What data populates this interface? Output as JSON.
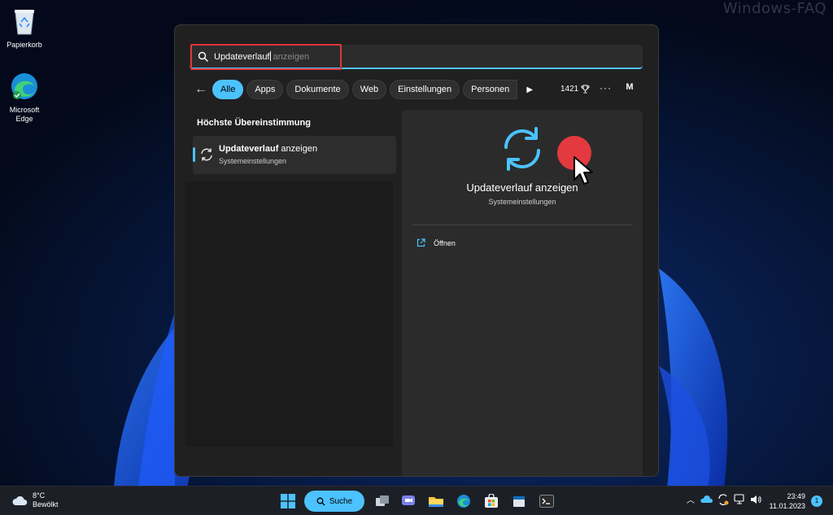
{
  "desktop": {
    "watermark": "Windows-FAQ",
    "icons": [
      {
        "label": "Papierkorb",
        "icon": "recycle-bin-icon"
      },
      {
        "label": "Microsoft Edge",
        "icon": "edge-icon"
      }
    ]
  },
  "search": {
    "query": "Updateverlauf",
    "suggestion": " anzeigen"
  },
  "filters": {
    "back": "←",
    "tabs": [
      "Alle",
      "Apps",
      "Dokumente",
      "Web",
      "Einstellungen",
      "Personen"
    ],
    "active_tab": "Alle",
    "play": "▶",
    "points": "1421",
    "more": "···",
    "account_initial": "M"
  },
  "results": {
    "section_title": "Höchste Übereinstimmung",
    "best_match": {
      "title_bold": "Updateverlauf",
      "title_rest": " anzeigen",
      "subtitle": "Systemeinstellungen"
    }
  },
  "detail": {
    "title": "Updateverlauf anzeigen",
    "subtitle": "Systemeinstellungen",
    "actions": [
      {
        "label": "Öffnen",
        "icon": "open-external-icon"
      }
    ]
  },
  "taskbar": {
    "weather_temp": "8°C",
    "weather_desc": "Bewölkt",
    "search_label": "Suche",
    "time": "23:49",
    "date": "11.01.2023",
    "notifications": "1"
  },
  "colors": {
    "accent": "#4cc2ff",
    "highlight": "#e0363a",
    "pane": "#2b2b2b",
    "flyout": "#202020"
  }
}
